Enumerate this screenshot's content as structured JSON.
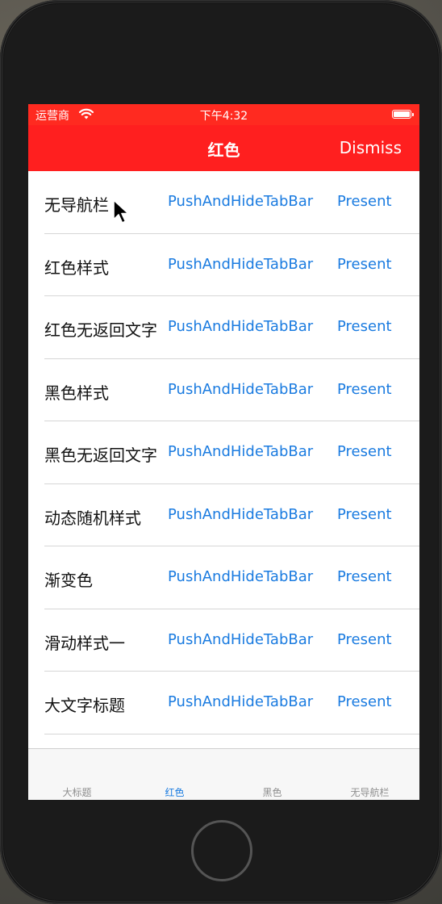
{
  "status_bar": {
    "carrier": "运营商",
    "time": "下午4:32"
  },
  "nav_bar": {
    "title": "红色",
    "right_button": "Dismiss"
  },
  "rows": [
    {
      "title": "无导航栏",
      "push": "PushAndHideTabBar",
      "present": "Present"
    },
    {
      "title": "红色样式",
      "push": "PushAndHideTabBar",
      "present": "Present"
    },
    {
      "title": "红色无返回文字",
      "push": "PushAndHideTabBar",
      "present": "Present"
    },
    {
      "title": "黑色样式",
      "push": "PushAndHideTabBar",
      "present": "Present"
    },
    {
      "title": "黑色无返回文字",
      "push": "PushAndHideTabBar",
      "present": "Present"
    },
    {
      "title": "动态随机样式",
      "push": "PushAndHideTabBar",
      "present": "Present"
    },
    {
      "title": "渐变色",
      "push": "PushAndHideTabBar",
      "present": "Present"
    },
    {
      "title": "滑动样式一",
      "push": "PushAndHideTabBar",
      "present": "Present"
    },
    {
      "title": "大文字标题",
      "push": "PushAndHideTabBar",
      "present": "Present"
    }
  ],
  "tab_bar": {
    "tabs": [
      "大标题",
      "红色",
      "黑色",
      "无导航栏"
    ],
    "active_index": 1
  },
  "colors": {
    "nav_red": "#ff1f1f",
    "link_blue": "#1a7be0",
    "tab_inactive": "#8e8e8e"
  },
  "icons": [
    "wifi-icon",
    "battery-icon",
    "mouse-cursor-icon",
    "home-button"
  ]
}
